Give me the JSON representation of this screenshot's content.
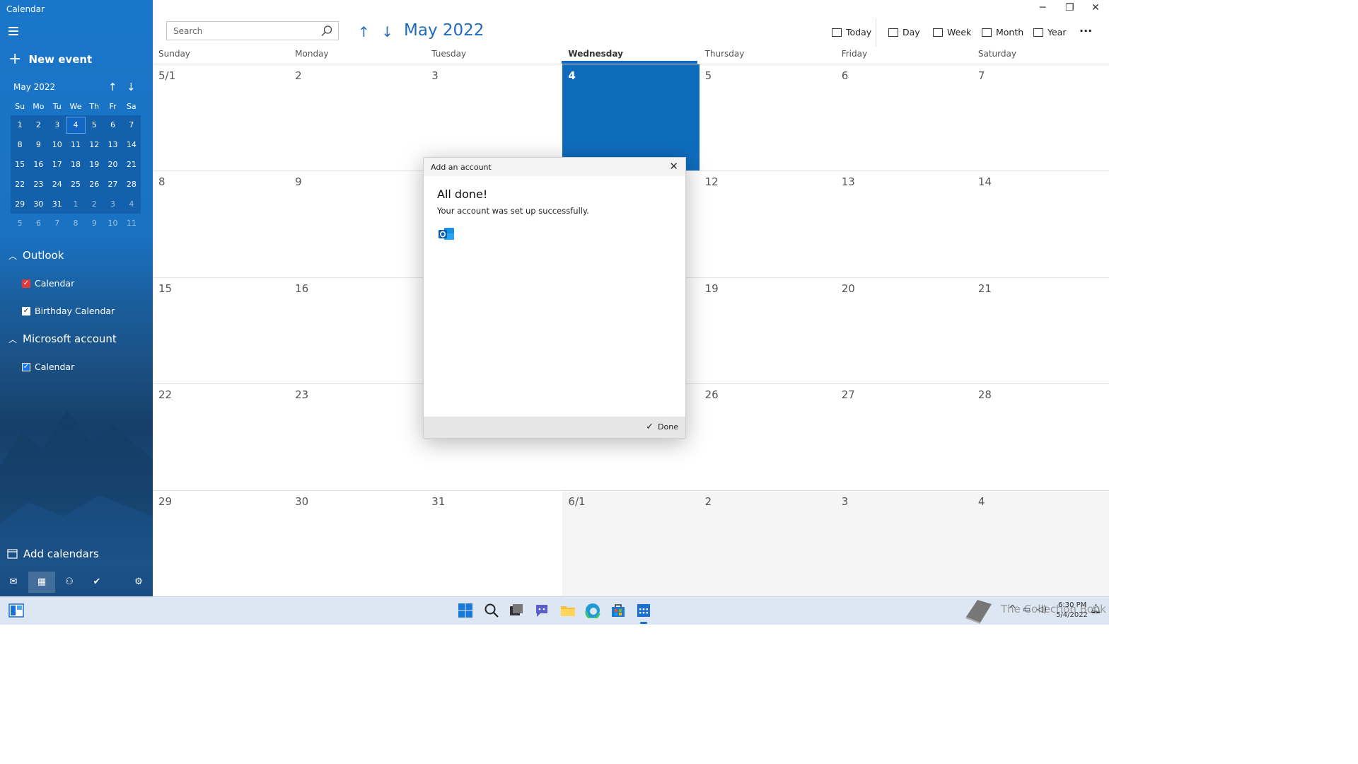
{
  "app": {
    "title": "Calendar"
  },
  "sidebar": {
    "new_event": "New event",
    "mini_month": "May 2022",
    "dow": [
      "Su",
      "Mo",
      "Tu",
      "We",
      "Th",
      "Fr",
      "Sa"
    ],
    "weeks": [
      [
        "1",
        "2",
        "3",
        "4",
        "5",
        "6",
        "7"
      ],
      [
        "8",
        "9",
        "10",
        "11",
        "12",
        "13",
        "14"
      ],
      [
        "15",
        "16",
        "17",
        "18",
        "19",
        "20",
        "21"
      ],
      [
        "22",
        "23",
        "24",
        "25",
        "26",
        "27",
        "28"
      ],
      [
        "29",
        "30",
        "31",
        "1",
        "2",
        "3",
        "4"
      ],
      [
        "5",
        "6",
        "7",
        "8",
        "9",
        "10",
        "11"
      ]
    ],
    "selected_day": "4",
    "groups": [
      {
        "label": "Outlook",
        "items": [
          {
            "label": "Calendar",
            "color": "#e03a3a",
            "checked": true
          },
          {
            "label": "Birthday Calendar",
            "color": "#ffffff",
            "checked": true
          }
        ]
      },
      {
        "label": "Microsoft account",
        "items": [
          {
            "label": "Calendar",
            "color": "#1a73e8",
            "checked": true
          }
        ]
      }
    ],
    "add_calendars": "Add calendars",
    "bottom_nav": [
      "mail-icon",
      "calendar-icon",
      "people-icon",
      "todo-icon",
      "settings-icon"
    ]
  },
  "header": {
    "search_placeholder": "Search",
    "month_title": "May 2022",
    "views": [
      "Today",
      "Day",
      "Week",
      "Month",
      "Year"
    ],
    "more": "···"
  },
  "week_days": [
    "Sunday",
    "Monday",
    "Tuesday",
    "Wednesday",
    "Thursday",
    "Friday",
    "Saturday"
  ],
  "today_index": 3,
  "grid": [
    [
      "5/1",
      "2",
      "3",
      "4",
      "5",
      "6",
      "7"
    ],
    [
      "8",
      "9",
      "",
      "",
      "12",
      "13",
      "14"
    ],
    [
      "15",
      "16",
      "",
      "",
      "19",
      "20",
      "21"
    ],
    [
      "22",
      "23",
      "",
      "",
      "26",
      "27",
      "28"
    ],
    [
      "29",
      "30",
      "31",
      "6/1",
      "2",
      "3",
      "4"
    ]
  ],
  "dialog": {
    "title": "Add an account",
    "heading": "All done!",
    "message": "Your account was set up successfully.",
    "done_label": "Done"
  },
  "taskbar": {
    "time": "6:30 PM",
    "date": "5/4/2022",
    "watermark": "The Collection Book"
  },
  "colors": {
    "accent": "#0f6cbd",
    "today_bar": "#1166c3"
  }
}
